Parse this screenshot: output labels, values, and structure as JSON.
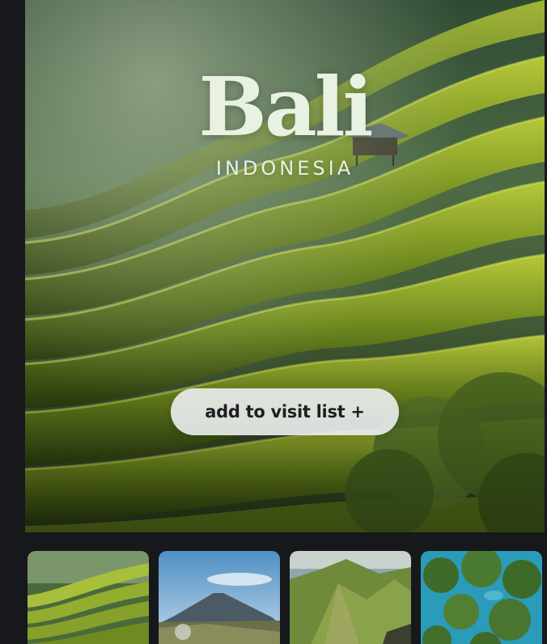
{
  "hero": {
    "title": "Bali",
    "subtitle": "INDONESIA",
    "cta_label": "add to visit list +"
  },
  "thumbnails": [
    {
      "subject": "rice terraces"
    },
    {
      "subject": "volcano"
    },
    {
      "subject": "green mountain coast"
    },
    {
      "subject": "tropical islands lagoon"
    }
  ],
  "colors": {
    "page_background": "#17181c",
    "title_color": "#e8f1e2",
    "button_background": "#eceef0",
    "button_text": "#1d1f22"
  }
}
